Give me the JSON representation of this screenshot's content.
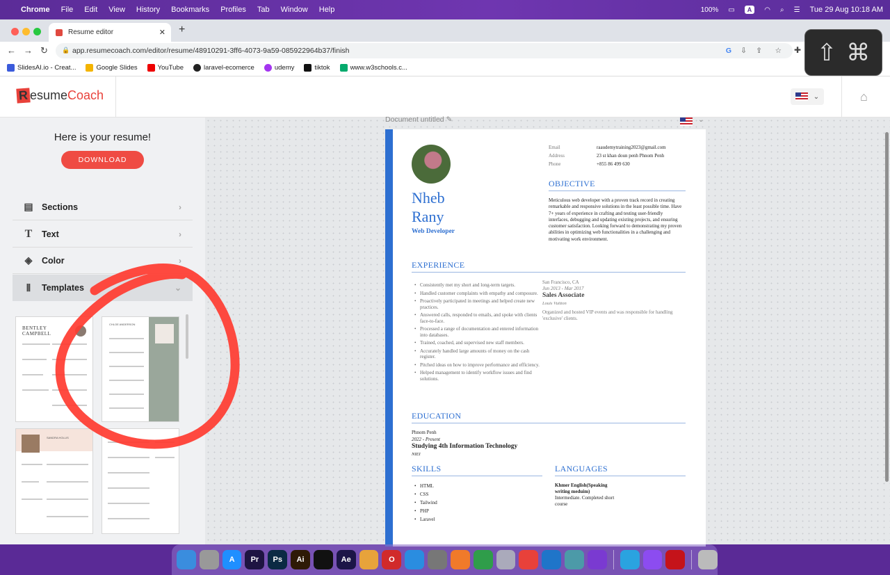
{
  "menubar": {
    "apple": "",
    "items": [
      "Chrome",
      "File",
      "Edit",
      "View",
      "History",
      "Bookmarks",
      "Profiles",
      "Tab",
      "Window",
      "Help"
    ],
    "battery": "100%",
    "input_badge": "A",
    "datetime": "Tue 29 Aug  10:18 AM"
  },
  "browser": {
    "tab_title": "Resume editor",
    "url": "app.resumecoach.com/editor/resume/48910291-3ff6-4073-9a59-085922964b37/finish",
    "bookmarks": [
      {
        "label": "SlidesAI.io - Creat...",
        "color": "#3b5bdb"
      },
      {
        "label": "Google Slides",
        "color": "#f4b400"
      },
      {
        "label": "YouTube",
        "color": "#e00"
      },
      {
        "label": "laravel-ecomerce",
        "color": "#222"
      },
      {
        "label": "udemy",
        "color": "#a435f0"
      },
      {
        "label": "tiktok",
        "color": "#111"
      },
      {
        "label": "www.w3schools.c...",
        "color": "#04aa6d"
      }
    ]
  },
  "app": {
    "logo_r": "R",
    "logo_esume": "esume",
    "logo_coach": "Coach",
    "sidebar": {
      "title": "Here is your resume!",
      "download": "DOWNLOAD",
      "items": [
        "Sections",
        "Text",
        "Color",
        "Templates"
      ],
      "template_names": [
        "BENTLEY CAMPBELL",
        "CHLOE ANDERSON",
        "SANDRA HOLLIS"
      ]
    },
    "document_title": "Document untitled"
  },
  "resume": {
    "contact_labels": [
      "Email",
      "Address",
      "Phone"
    ],
    "contact_values": [
      "raaudemytraining2023@gmail.com",
      "23 st khan doun penh Phnom Penh",
      "+855 86 499 630"
    ],
    "first_name": "Nheb",
    "last_name": "Rany",
    "role": "Web Developer",
    "objective_title": "OBJECTIVE",
    "objective": "Meticulous web developer with a proven track record in creating remarkable and responsive solutions in the least possible time. Have 7+ years of experience in crafting and testing user-friendly interfaces, debugging and updating existing projects, and ensuring customer satisfaction. Looking forward to demonstrating my proven abilities in optimizing web functionalities in a challenging and motivating work environment.",
    "experience_title": "EXPERIENCE",
    "experience_bullets": [
      "Consistently met my short and long-term targets.",
      "Handled customer complaints with empathy and composure.",
      "Proactively participated in meetings and helped create new practices.",
      "Answered calls, responded to emails, and spoke with clients face-to-face.",
      "Processed a range of documentation and entered information into databases.",
      "Trained, coached, and supervised new staff members.",
      "Accurately handled large amounts of money on the cash register.",
      "Pitched ideas on how to improve performance and efficiency.",
      "Helped management to identify workflow issues and find solutions."
    ],
    "job_location": "San Francisco, CA",
    "job_dates": "Jun 2013 - Mar 2017",
    "job_title": "Sales Associate",
    "job_company": "Louis Vuitton",
    "job_desc": "Organized and hosted VIP events and was responsible for handling 'exclusive' clients.",
    "education_title": "EDUCATION",
    "edu_location": "Phnom Penh",
    "edu_dates": "2022 - Present",
    "edu_degree": "Studying 4th Information Technology",
    "edu_school": "NIEI",
    "skills_title": "SKILLS",
    "skills": [
      "HTML",
      "CSS",
      "Tailwind",
      "PHP",
      "Laravel"
    ],
    "languages_title": "LANGUAGES",
    "language_name": "Khmer English(Speaking writing meduim)",
    "language_level": "Intermediate. Completed short course"
  },
  "dock_apps": [
    {
      "name": "Finder",
      "label": "",
      "color": "#3a8dde"
    },
    {
      "name": "Launchpad",
      "label": "",
      "color": "#999"
    },
    {
      "name": "App Store",
      "label": "A",
      "color": "#1f8fff"
    },
    {
      "name": "Premiere Pro",
      "label": "Pr",
      "color": "#1e1442"
    },
    {
      "name": "Photoshop",
      "label": "Ps",
      "color": "#0b2a44"
    },
    {
      "name": "Illustrator",
      "label": "Ai",
      "color": "#2e1a06"
    },
    {
      "name": "CapCut",
      "label": "",
      "color": "#111"
    },
    {
      "name": "After Effects",
      "label": "Ae",
      "color": "#1c1547"
    },
    {
      "name": "Photos",
      "label": "",
      "color": "#e7a33b"
    },
    {
      "name": "Opera",
      "label": "O",
      "color": "#d12a2a"
    },
    {
      "name": "Safari",
      "label": "",
      "color": "#2a8de0"
    },
    {
      "name": "System Settings",
      "label": "",
      "color": "#777"
    },
    {
      "name": "Sketch",
      "label": "",
      "color": "#f07a2a"
    },
    {
      "name": "Chrome",
      "label": "",
      "color": "#2f9d4a"
    },
    {
      "name": "Utilities",
      "label": "",
      "color": "#aab"
    },
    {
      "name": "Anydesk",
      "label": "",
      "color": "#e8413a"
    },
    {
      "name": "VS Code",
      "label": "",
      "color": "#1f75c9"
    },
    {
      "name": "Preview",
      "label": "",
      "color": "#4c9aa8"
    },
    {
      "name": "Firefox",
      "label": "",
      "color": "#7a3ad1"
    },
    {
      "name": "Telegram",
      "label": "",
      "color": "#2aa3e0"
    },
    {
      "name": "Messenger",
      "label": "",
      "color": "#8c4cf0"
    },
    {
      "name": "Acrobat",
      "label": "",
      "color": "#c5131a"
    },
    {
      "name": "Trash",
      "label": "",
      "color": "#bbb"
    }
  ],
  "colors": {
    "accent": "#2d6fd1",
    "brand": "#e8413a",
    "annotation": "#ff3b30"
  }
}
